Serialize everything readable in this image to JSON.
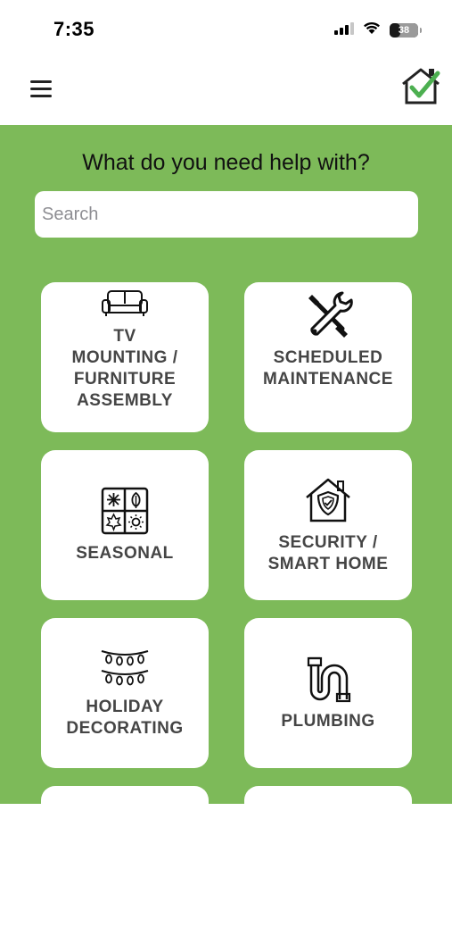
{
  "status_bar": {
    "time": "7:35",
    "battery_level": "38",
    "battery_fill_fraction": 0.38,
    "signal_icon": "cellular-signal-icon",
    "wifi_icon": "wifi-icon",
    "battery_icon": "battery-icon"
  },
  "header": {
    "menu_icon": "hamburger-menu-icon",
    "logo_icon": "house-checkmark-logo"
  },
  "main": {
    "heading": "What do you need help with?",
    "search": {
      "placeholder": "Search",
      "value": ""
    },
    "categories": [
      {
        "label": "TV\nMOUNTING /\nFURNITURE\nASSEMBLY",
        "icon": "sofa-icon"
      },
      {
        "label": "SCHEDULED\nMAINTENANCE",
        "icon": "wrench-screwdriver-icon"
      },
      {
        "label": "SEASONAL",
        "icon": "seasons-grid-icon"
      },
      {
        "label": "SECURITY  /\nSMART HOME",
        "icon": "house-shield-icon"
      },
      {
        "label": "HOLIDAY\nDECORATING",
        "icon": "string-lights-icon"
      },
      {
        "label": "PLUMBING",
        "icon": "pipe-icon"
      },
      {
        "label": "",
        "icon": ""
      },
      {
        "label": "",
        "icon": ""
      }
    ]
  },
  "colors": {
    "background_green": "#7dba59",
    "tile_background": "#ffffff",
    "tile_text": "#454545",
    "logo_green": "#4caf50"
  }
}
